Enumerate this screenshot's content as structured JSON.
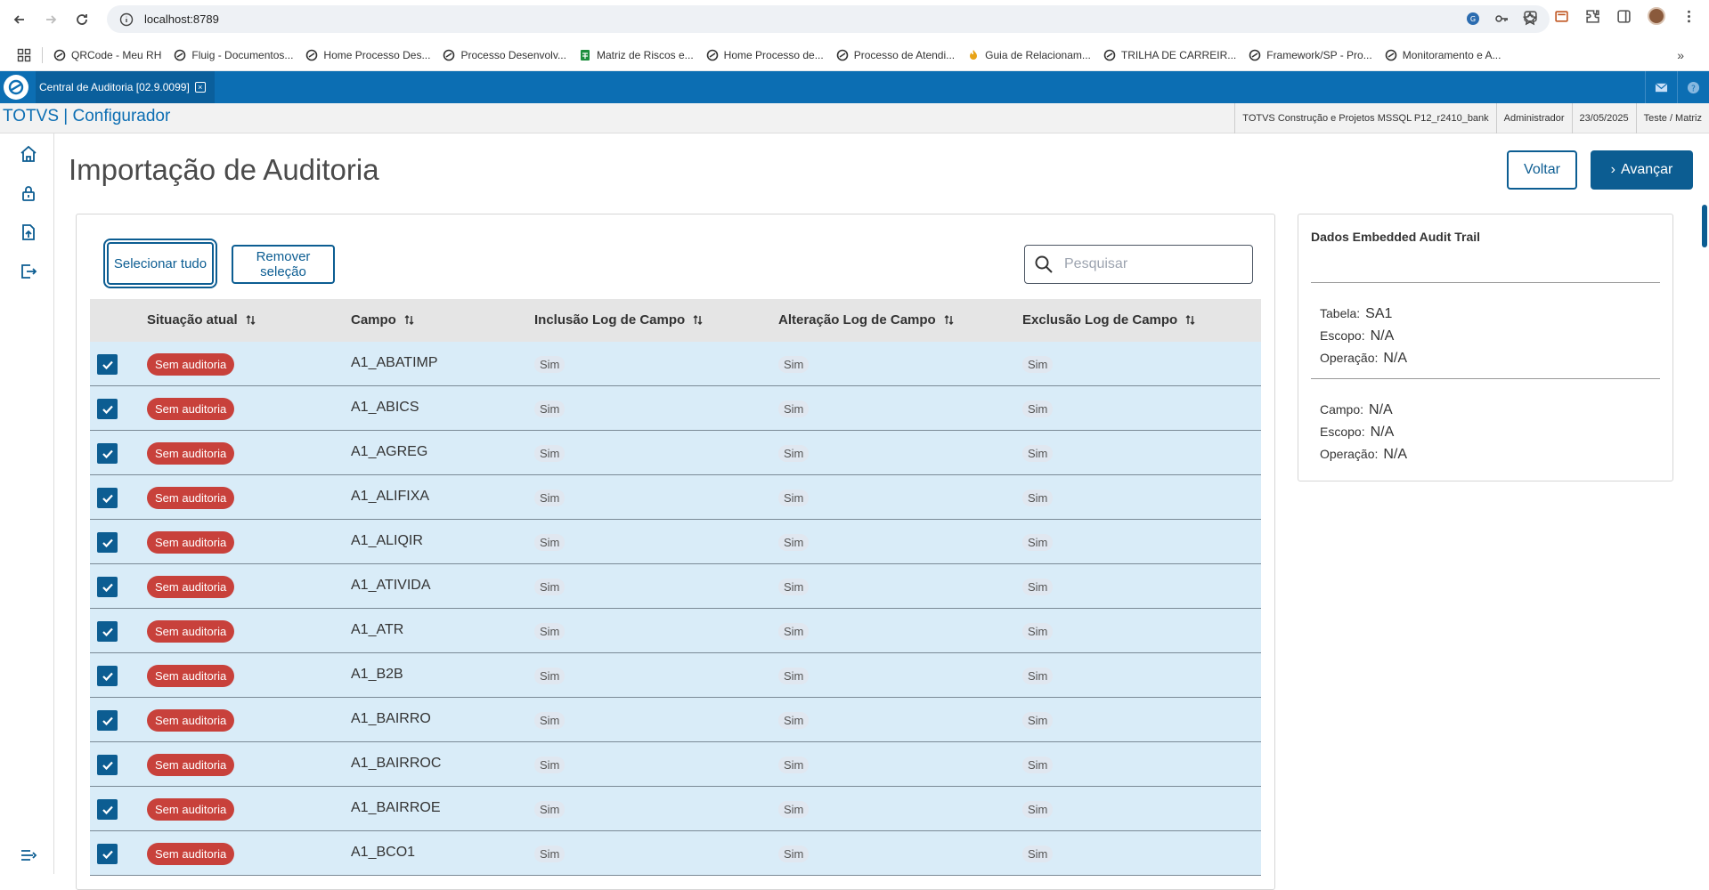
{
  "browser": {
    "url": "localhost:8789",
    "bookmarks": [
      "QRCode - Meu RH",
      "Fluig - Documentos...",
      "Home Processo Des...",
      "Processo Desenvolv...",
      "Matriz de Riscos e...",
      "Home Processo de...",
      "Processo de Atendi...",
      "Guia de Relacionam...",
      "TRILHA DE CARREIR...",
      "Framework/SP - Pro...",
      "Monitoramento e A..."
    ],
    "more": "»"
  },
  "app": {
    "tab_title": "Central de Auditoria [02.9.0099]",
    "tab_close": "×",
    "brand": "TOTVS | Configurador",
    "context": [
      "TOTVS Construção e Projetos MSSQL P12_r2410_bank",
      "Administrador",
      "23/05/2025",
      "Teste / Matriz"
    ]
  },
  "page": {
    "title": "Importação de Auditoria",
    "back_label": "Voltar",
    "next_label": "Avançar",
    "next_prefix": "›"
  },
  "grid": {
    "select_all_label": "Selecionar tudo",
    "remove_selection_label": "Remover seleção",
    "search_placeholder": "Pesquisar",
    "columns": [
      "Situação atual",
      "Campo",
      "Inclusão Log de Campo",
      "Alteração Log de Campo",
      "Exclusão Log de Campo"
    ],
    "rows": [
      {
        "status": "Sem auditoria",
        "campo": "A1_ABATIMP",
        "inc": "Sim",
        "alt": "Sim",
        "exc": "Sim"
      },
      {
        "status": "Sem auditoria",
        "campo": "A1_ABICS",
        "inc": "Sim",
        "alt": "Sim",
        "exc": "Sim"
      },
      {
        "status": "Sem auditoria",
        "campo": "A1_AGREG",
        "inc": "Sim",
        "alt": "Sim",
        "exc": "Sim"
      },
      {
        "status": "Sem auditoria",
        "campo": "A1_ALIFIXA",
        "inc": "Sim",
        "alt": "Sim",
        "exc": "Sim"
      },
      {
        "status": "Sem auditoria",
        "campo": "A1_ALIQIR",
        "inc": "Sim",
        "alt": "Sim",
        "exc": "Sim"
      },
      {
        "status": "Sem auditoria",
        "campo": "A1_ATIVIDA",
        "inc": "Sim",
        "alt": "Sim",
        "exc": "Sim"
      },
      {
        "status": "Sem auditoria",
        "campo": "A1_ATR",
        "inc": "Sim",
        "alt": "Sim",
        "exc": "Sim"
      },
      {
        "status": "Sem auditoria",
        "campo": "A1_B2B",
        "inc": "Sim",
        "alt": "Sim",
        "exc": "Sim"
      },
      {
        "status": "Sem auditoria",
        "campo": "A1_BAIRRO",
        "inc": "Sim",
        "alt": "Sim",
        "exc": "Sim"
      },
      {
        "status": "Sem auditoria",
        "campo": "A1_BAIRROC",
        "inc": "Sim",
        "alt": "Sim",
        "exc": "Sim"
      },
      {
        "status": "Sem auditoria",
        "campo": "A1_BAIRROE",
        "inc": "Sim",
        "alt": "Sim",
        "exc": "Sim"
      },
      {
        "status": "Sem auditoria",
        "campo": "A1_BCO1",
        "inc": "Sim",
        "alt": "Sim",
        "exc": "Sim"
      }
    ]
  },
  "panel": {
    "title": "Dados Embedded Audit Trail",
    "table_label": "Tabela:",
    "table_value": "SA1",
    "scope_label": "Escopo:",
    "scope_value": "N/A",
    "op_label": "Operação:",
    "op_value": "N/A",
    "field_label": "Campo:",
    "field_value": "N/A",
    "field_scope_label": "Escopo:",
    "field_scope_value": "N/A",
    "field_op_label": "Operação:",
    "field_op_value": "N/A"
  }
}
